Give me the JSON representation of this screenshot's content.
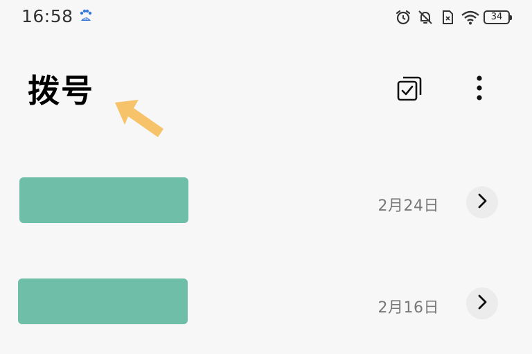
{
  "status_bar": {
    "time": "16:58",
    "battery_level": "34",
    "icons": [
      "app-notification-icon",
      "alarm-icon",
      "notifications-off-icon",
      "no-sim-icon",
      "wifi-icon",
      "battery-icon"
    ]
  },
  "header": {
    "title": "拨号",
    "actions": [
      "multi-select-icon",
      "more-vert-icon"
    ]
  },
  "call_log": [
    {
      "date": "2月24日",
      "name_redacted": true
    },
    {
      "date": "2月16日",
      "name_redacted": true
    }
  ],
  "colors": {
    "background": "#f7f7f7",
    "redaction": "#6fbfa8",
    "annotation_arrow": "#f6c26a",
    "date_text": "#777777"
  }
}
